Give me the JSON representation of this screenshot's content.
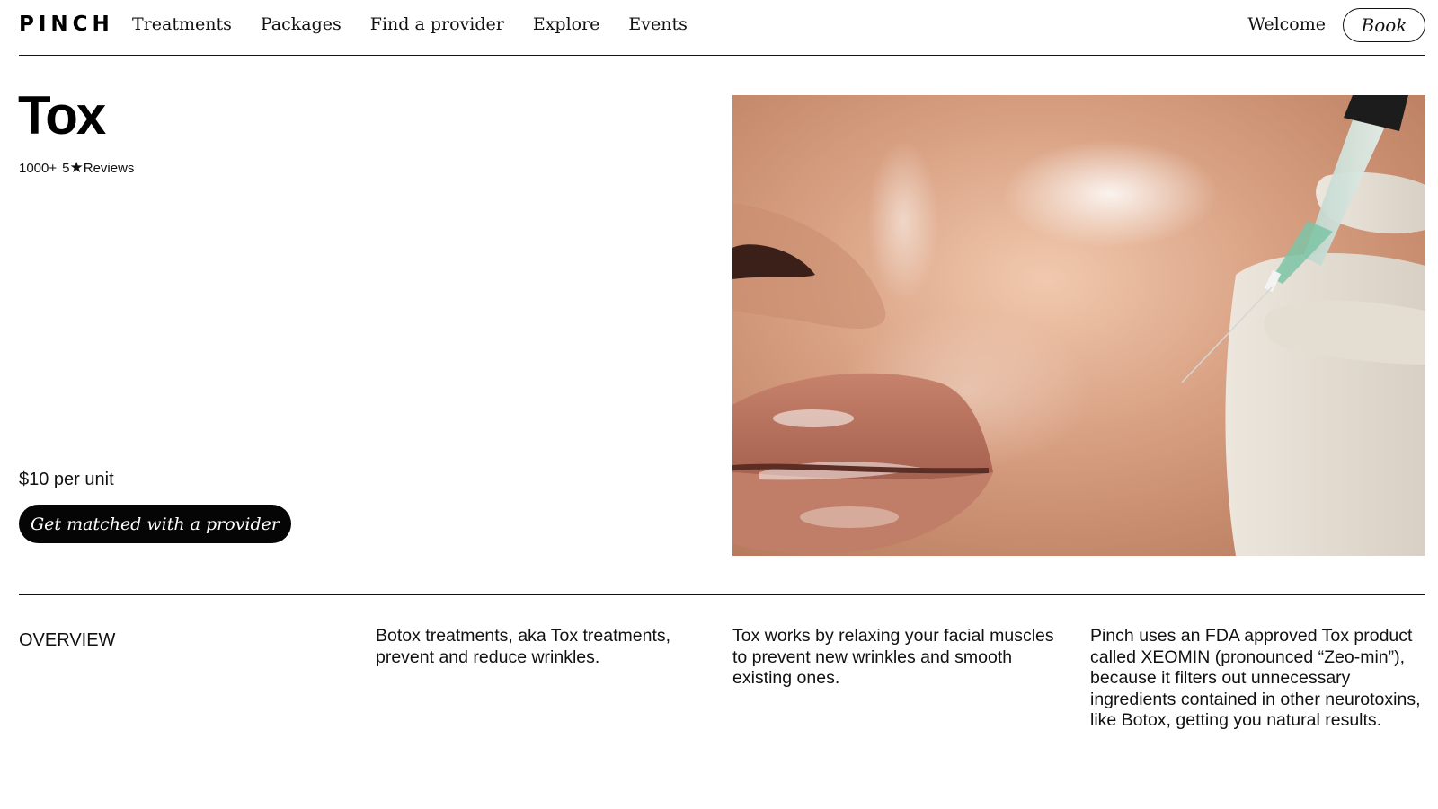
{
  "brand": {
    "logo": "PINCH"
  },
  "nav": {
    "items": [
      {
        "label": "Treatments"
      },
      {
        "label": "Packages"
      },
      {
        "label": "Find a provider"
      },
      {
        "label": "Explore"
      },
      {
        "label": "Events"
      }
    ],
    "welcome": "Welcome",
    "book_label": "Book"
  },
  "product": {
    "title": "Tox",
    "review_count": "1000+",
    "rating": "5",
    "rating_icon": "star-icon",
    "reviews_label": "Reviews",
    "price": "$10 per unit",
    "cta_label": "Get matched with a provider"
  },
  "overview": {
    "label": "OVERVIEW",
    "columns": [
      {
        "text": "Botox treatments, aka Tox treatments, prevent and reduce wrinkles."
      },
      {
        "text": "Tox works by relaxing your facial muscles to prevent new wrinkles and smooth existing ones."
      },
      {
        "text": "Pinch uses an FDA approved Tox product called XEOMIN (pronounced “Zeo-min”), because it filters out unnecessary ingredients contained in other neurotoxins, like Botox, getting you natural results."
      }
    ]
  },
  "colors": {
    "text": "#0a0a0a",
    "cta_bg": "#050505",
    "cta_text": "#ffffff",
    "background": "#ffffff"
  }
}
